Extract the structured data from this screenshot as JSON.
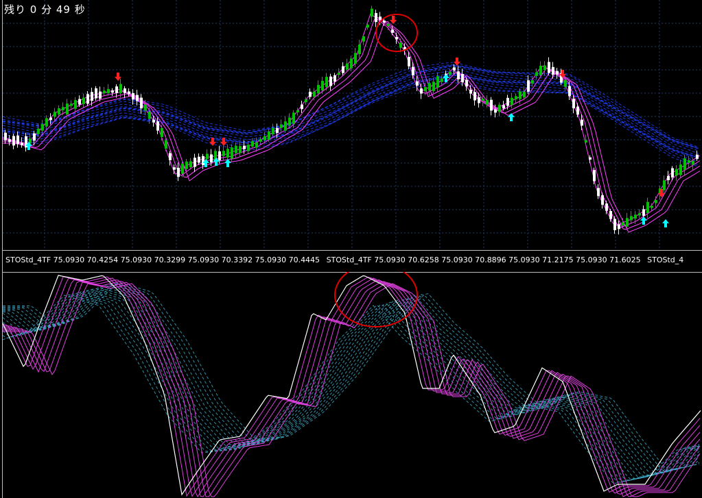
{
  "timer": {
    "label": "残り 0 分 49 秒"
  },
  "indicator_label": {
    "segments": [
      "STOStd_4TF 75.0930 70.4254 75.0930 70.3299 75.0930 70.3392 75.0930 70.4445",
      "STOStd_4TF 75.0930 70.6258 75.0930 70.8896 75.0930 71.2175 75.0930 71.6025",
      "STOStd_4"
    ]
  },
  "colors": {
    "background": "#000000",
    "grid": "#1f3a66",
    "bull_candle": "#00c000",
    "bear_candle": "#ffffff",
    "ma_fast": "#ff40ff",
    "ma_slow": "#2040ff",
    "osc_line": "#ffffff",
    "osc_fast": "#e040e0",
    "osc_slow": "#40b0d0",
    "arrow_up": "#00ffff",
    "arrow_down": "#ff2020",
    "highlight_circle": "#e00000"
  }
}
